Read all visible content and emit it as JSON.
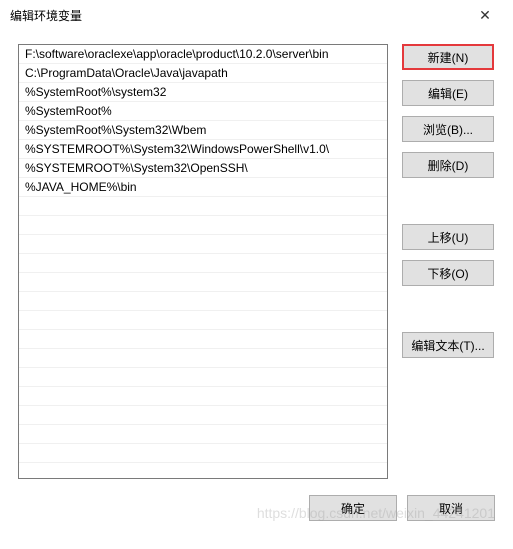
{
  "window": {
    "title": "编辑环境变量"
  },
  "paths": [
    "F:\\software\\oraclexe\\app\\oracle\\product\\10.2.0\\server\\bin",
    "C:\\ProgramData\\Oracle\\Java\\javapath",
    "%SystemRoot%\\system32",
    "%SystemRoot%",
    "%SystemRoot%\\System32\\Wbem",
    "%SYSTEMROOT%\\System32\\WindowsPowerShell\\v1.0\\",
    "%SYSTEMROOT%\\System32\\OpenSSH\\",
    "%JAVA_HOME%\\bin"
  ],
  "buttons": {
    "new": "新建(N)",
    "edit": "编辑(E)",
    "browse": "浏览(B)...",
    "delete": "删除(D)",
    "moveup": "上移(U)",
    "movedown": "下移(O)",
    "edittext": "编辑文本(T)...",
    "ok": "确定",
    "cancel": "取消"
  },
  "watermark": "https://blog.csdn.net/weixin_44241201"
}
